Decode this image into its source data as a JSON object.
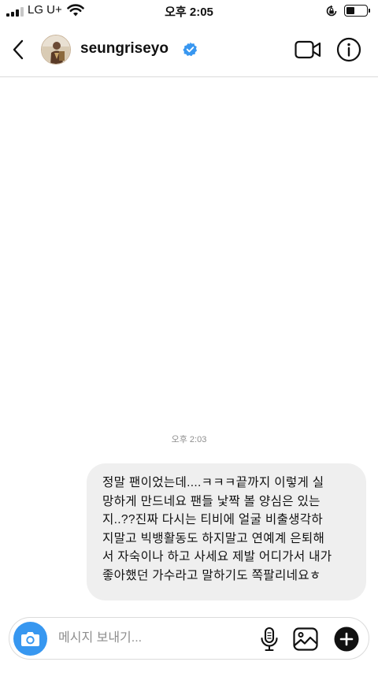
{
  "status_bar": {
    "carrier": "LG U+",
    "time": "오후 2:05",
    "battery_level": 0.4,
    "signal_bars": 3,
    "icons": [
      "signal-icon",
      "wifi-icon",
      "rotation-lock-icon",
      "battery-icon"
    ]
  },
  "header": {
    "username": "seungriseyo",
    "verified": true,
    "icons": [
      "back-icon",
      "avatar",
      "verified-badge-icon",
      "video-call-icon",
      "info-icon"
    ]
  },
  "conversation": {
    "timestamp": "오후 2:03",
    "messages": [
      {
        "text": "정말 팬이었는데....ㅋㅋㅋ끝까지 이렇게 실\n망하게 만드네요 팬들 낯짝 볼 양심은 있는\n지..??진짜 다시는 티비에 얼굴 비출생각하\n지말고 빅뱅활동도 하지말고 연예계 은퇴해\n서 자숙이나 하고 사세요 제발 어디가서 내가\n좋아했던 가수라고 말하기도 쪽팔리네요ㅎ"
      }
    ]
  },
  "composer": {
    "placeholder": "메시지 보내기...",
    "value": "",
    "icons": [
      "camera-icon",
      "microphone-icon",
      "gallery-icon",
      "plus-icon"
    ]
  },
  "colors": {
    "accent": "#3797f0",
    "bubble": "#efefef",
    "text": "#111111",
    "muted": "#8e8e8e",
    "divider": "#dbdbdb"
  }
}
